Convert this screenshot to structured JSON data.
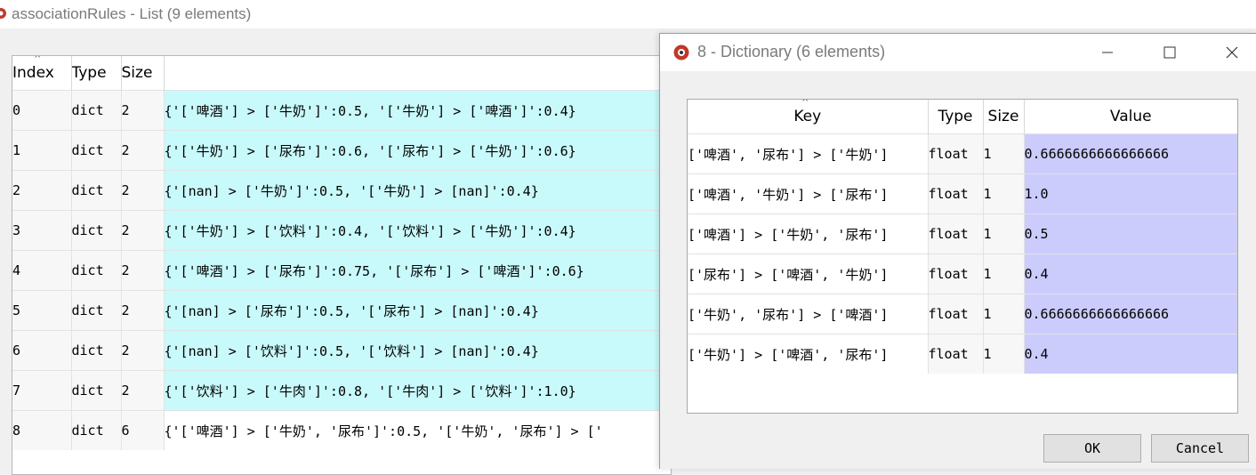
{
  "list_window": {
    "title": "associationRules - List (9 elements)",
    "columns": [
      "Index",
      "Type",
      "Size"
    ],
    "rows": [
      {
        "index": "0",
        "type": "dict",
        "size": "2",
        "value": "{'['啤酒'] > ['牛奶']':0.5, '['牛奶'] > ['啤酒']':0.4}"
      },
      {
        "index": "1",
        "type": "dict",
        "size": "2",
        "value": "{'['牛奶'] > ['尿布']':0.6, '['尿布'] > ['牛奶']':0.6}"
      },
      {
        "index": "2",
        "type": "dict",
        "size": "2",
        "value": "{'[nan] > ['牛奶']':0.5, '['牛奶'] > [nan]':0.4}"
      },
      {
        "index": "3",
        "type": "dict",
        "size": "2",
        "value": "{'['牛奶'] > ['饮料']':0.4, '['饮料'] > ['牛奶']':0.4}"
      },
      {
        "index": "4",
        "type": "dict",
        "size": "2",
        "value": "{'['啤酒'] > ['尿布']':0.75, '['尿布'] > ['啤酒']':0.6}"
      },
      {
        "index": "5",
        "type": "dict",
        "size": "2",
        "value": "{'[nan] > ['尿布']':0.5, '['尿布'] > [nan]':0.4}"
      },
      {
        "index": "6",
        "type": "dict",
        "size": "2",
        "value": "{'[nan] > ['饮料']':0.5, '['饮料'] > [nan]':0.4}"
      },
      {
        "index": "7",
        "type": "dict",
        "size": "2",
        "value": "{'['饮料'] > ['牛肉']':0.8, '['牛肉'] > ['饮料']':1.0}"
      },
      {
        "index": "8",
        "type": "dict",
        "size": "6",
        "value": "{'['啤酒'] > ['牛奶', '尿布']':0.5, '['牛奶', '尿布'] > ['"
      }
    ]
  },
  "dict_dialog": {
    "title": "8 - Dictionary (6 elements)",
    "columns": [
      "Key",
      "Type",
      "Size",
      "Value"
    ],
    "rows": [
      {
        "key": "['啤酒', '尿布'] > ['牛奶']",
        "type": "float",
        "size": "1",
        "value": "0.6666666666666666"
      },
      {
        "key": "['啤酒', '牛奶'] > ['尿布']",
        "type": "float",
        "size": "1",
        "value": "1.0"
      },
      {
        "key": "['啤酒'] > ['牛奶', '尿布']",
        "type": "float",
        "size": "1",
        "value": "0.5"
      },
      {
        "key": "['尿布'] > ['啤酒', '牛奶']",
        "type": "float",
        "size": "1",
        "value": "0.4"
      },
      {
        "key": "['牛奶', '尿布'] > ['啤酒']",
        "type": "float",
        "size": "1",
        "value": "0.6666666666666666"
      },
      {
        "key": "['牛奶'] > ['啤酒', '尿布']",
        "type": "float",
        "size": "1",
        "value": "0.4"
      }
    ],
    "ok_label": "OK",
    "cancel_label": "Cancel"
  },
  "colors": {
    "list_value_bg": "#c9fafb",
    "dict_value_bg": "#ccccfc"
  },
  "icons": [
    "app-icon",
    "minimize-icon",
    "maximize-icon",
    "close-icon",
    "sort-caret-icon"
  ]
}
